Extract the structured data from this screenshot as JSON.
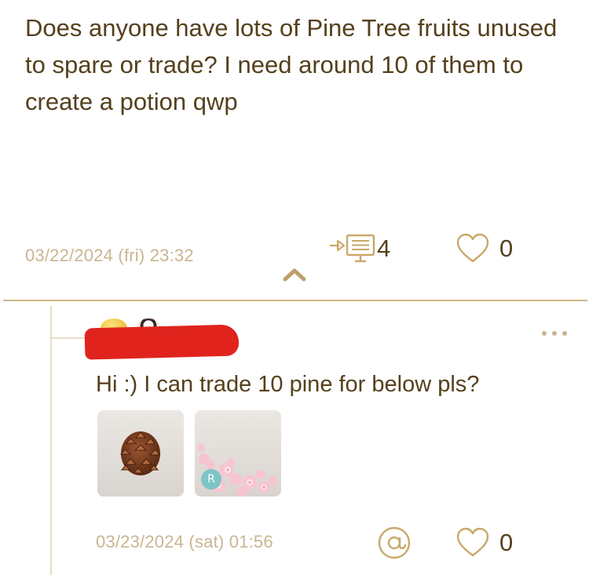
{
  "post": {
    "body": "Does anyone have lots of Pine Tree fruits unused to spare or trade? I need around 10 of them to create a potion qwp",
    "date": "03/22/2024 (fri) 23:32",
    "reply_count": "4",
    "like_count": "0"
  },
  "reply": {
    "text": "Hi :) I can trade 10 pine for below pls?",
    "date": "03/23/2024 (sat) 01:56",
    "like_count": "0",
    "images": [
      {
        "icon": "pine-cone-icon"
      },
      {
        "icon": "cherry-blossom-icon",
        "badge": "R"
      }
    ]
  },
  "colors": {
    "text": "#55401c",
    "meta": "#c9b591",
    "accent": "#cdb583",
    "redaction": "#e0241d",
    "badge": "#7cc5c7"
  }
}
